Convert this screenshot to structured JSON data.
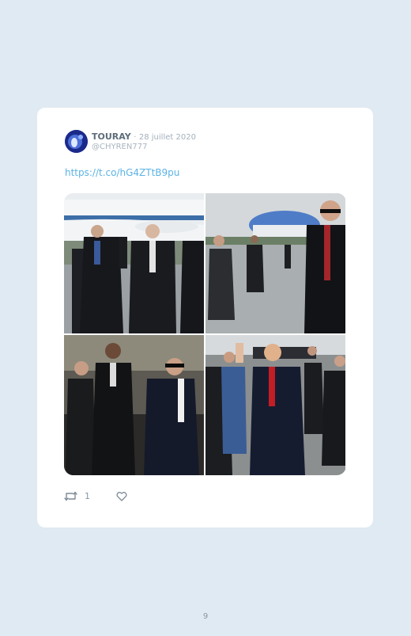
{
  "tweet": {
    "author_name": "TOURAY",
    "separator": "·",
    "date": "28 juillet 2020",
    "handle": "@CHYREN777",
    "link_text": "https://t.co/hG4ZTtB9pu",
    "photos": [
      {
        "name": "Photo of men in suits walking in front of Air Force One"
      },
      {
        "name": "Photo of agent near Air Force One on tarmac"
      },
      {
        "name": "Photo of men walking with sunglasses near vehicles"
      },
      {
        "name": "Photo of man waving on tarmac surrounded by agents"
      }
    ],
    "retweet_count": "1",
    "icons": {
      "retweet": "retweet-icon",
      "like": "heart-icon"
    }
  },
  "footer": {
    "page_number": "9"
  },
  "colors": {
    "background": "#dfeaf2",
    "card": "#ffffff",
    "link": "#5bb3e4",
    "muted": "#a9b4be"
  }
}
